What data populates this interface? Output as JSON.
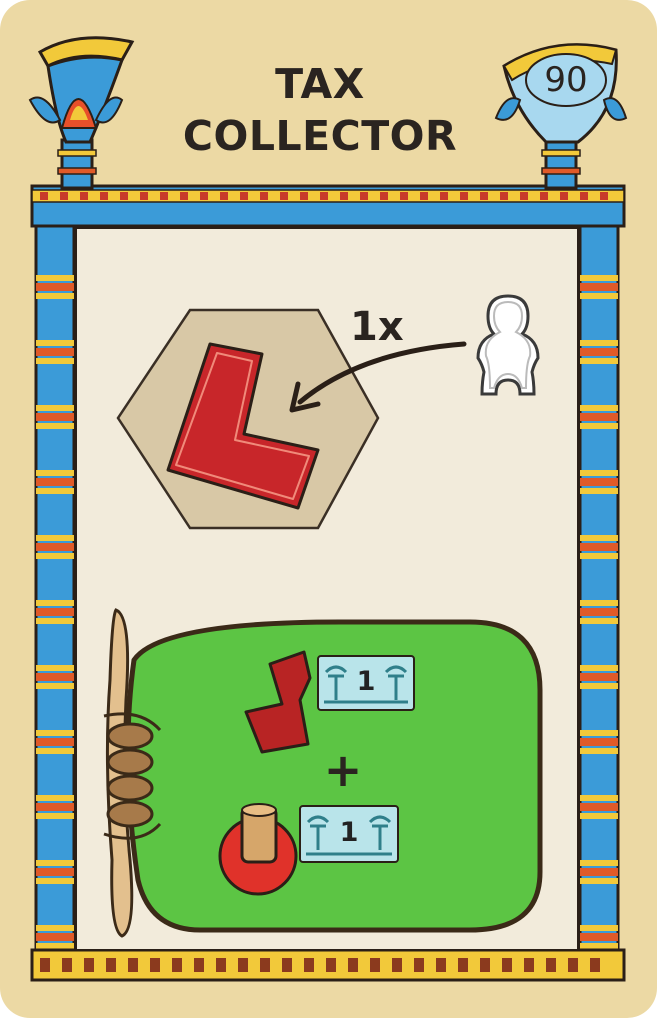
{
  "card": {
    "title_line1": "TAX",
    "title_line2": "COLLECTOR",
    "number": "90",
    "action_multiplier": "1x",
    "plus_sign": "+",
    "rewards": [
      {
        "item": "red-l-tile",
        "value": "1"
      },
      {
        "item": "worker-token",
        "value": "1"
      }
    ]
  },
  "colors": {
    "card_background": "#ecd9a4",
    "border_blue": "#3b9bd8",
    "parchment": "#f2ebdb",
    "bag_green": "#5cc544",
    "tile_red": "#c8262a",
    "icon_background": "#b9e4ea"
  },
  "icons": [
    "lotus-pillar-icon",
    "papyrus-pillar-icon",
    "hexagon-tile-icon",
    "red-l-tile-icon",
    "arrow-icon",
    "meeple-outline-icon",
    "money-bag-icon",
    "papyrus-money-icon",
    "worker-token-icon"
  ]
}
